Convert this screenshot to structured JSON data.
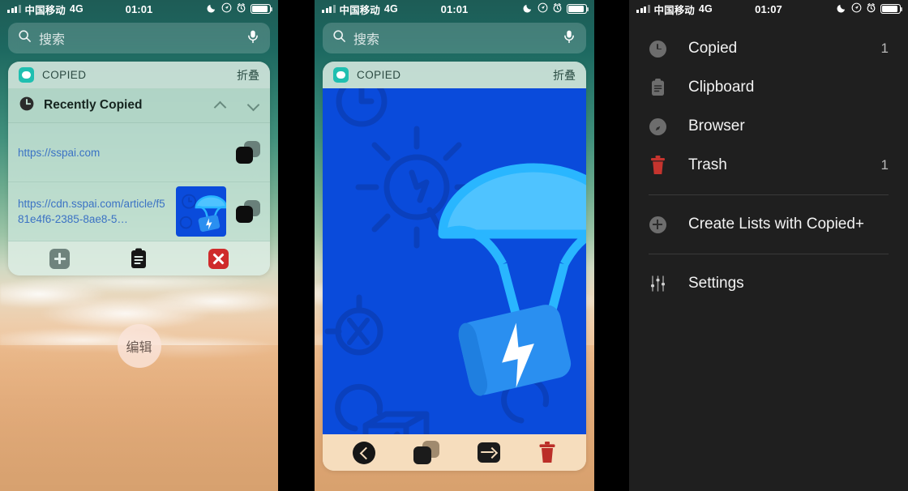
{
  "panels": [
    {
      "id": "home-screen-widget",
      "status_bar": {
        "carrier": "中国移动",
        "network": "4G",
        "time": "01:01",
        "icons": [
          "moon-icon",
          "location-icon",
          "alarm-icon",
          "battery-icon"
        ]
      },
      "search": {
        "placeholder": "搜索",
        "icon": "search-icon",
        "mic_icon": "microphone-icon"
      },
      "widget": {
        "app_name": "COPIED",
        "collapse_label": "折叠",
        "section_title": "Recently Copied",
        "section_icon": "clock-icon",
        "rows": [
          {
            "url": "https://sspai.com",
            "has_thumb": false,
            "action_icon": "copy-icon"
          },
          {
            "url": "https://cdn.sspai.com/article/f581e4f6-2385-8ae8-5…",
            "has_thumb": true,
            "action_icon": "copy-icon"
          }
        ],
        "footer": [
          {
            "name": "add-button",
            "icon": "plus-icon"
          },
          {
            "name": "clipboard-button",
            "icon": "clipboard-icon"
          },
          {
            "name": "clear-button",
            "icon": "close-icon"
          }
        ]
      },
      "edit_button": "编辑"
    },
    {
      "id": "image-preview-widget",
      "status_bar": {
        "carrier": "中国移动",
        "network": "4G",
        "time": "01:01",
        "icons": [
          "moon-icon",
          "location-icon",
          "alarm-icon",
          "battery-icon"
        ]
      },
      "search": {
        "placeholder": "搜索",
        "icon": "search-icon",
        "mic_icon": "microphone-icon"
      },
      "widget": {
        "app_name": "COPIED",
        "collapse_label": "折叠",
        "preview_alt": "parachute-illustration"
      },
      "toolbar": [
        {
          "name": "back-button",
          "icon": "chevron-left-icon"
        },
        {
          "name": "copy-button",
          "icon": "copy-icon"
        },
        {
          "name": "open-in-app-button",
          "icon": "arrow-into-box-icon"
        },
        {
          "name": "delete-button",
          "icon": "trash-icon"
        }
      ]
    },
    {
      "id": "copied-app-menu",
      "status_bar": {
        "carrier": "中国移动",
        "network": "4G",
        "time": "01:07",
        "icons": [
          "moon-icon",
          "location-icon",
          "alarm-icon",
          "battery-icon"
        ]
      },
      "menu_groups": [
        {
          "items": [
            {
              "label": "Copied",
              "icon": "clock-icon",
              "count": "1"
            },
            {
              "label": "Clipboard",
              "icon": "clipboard-icon",
              "count": ""
            },
            {
              "label": "Browser",
              "icon": "compass-icon",
              "count": ""
            },
            {
              "label": "Trash",
              "icon": "trash-icon",
              "count": "1"
            }
          ]
        },
        {
          "items": [
            {
              "label": "Create Lists with Copied+",
              "icon": "plus-circle-icon",
              "count": ""
            }
          ]
        },
        {
          "items": [
            {
              "label": "Settings",
              "icon": "sliders-icon",
              "count": ""
            }
          ]
        }
      ]
    }
  ],
  "colors": {
    "accent_teal": "#1fbfb0",
    "link_blue": "#3b72c4",
    "brand_blue": "#0a4bdb",
    "danger_red": "#cf2b2b",
    "trash_red": "#c5342e",
    "toolbar_sand": "#f6ddbd",
    "menu_bg": "#1f1f1f"
  }
}
